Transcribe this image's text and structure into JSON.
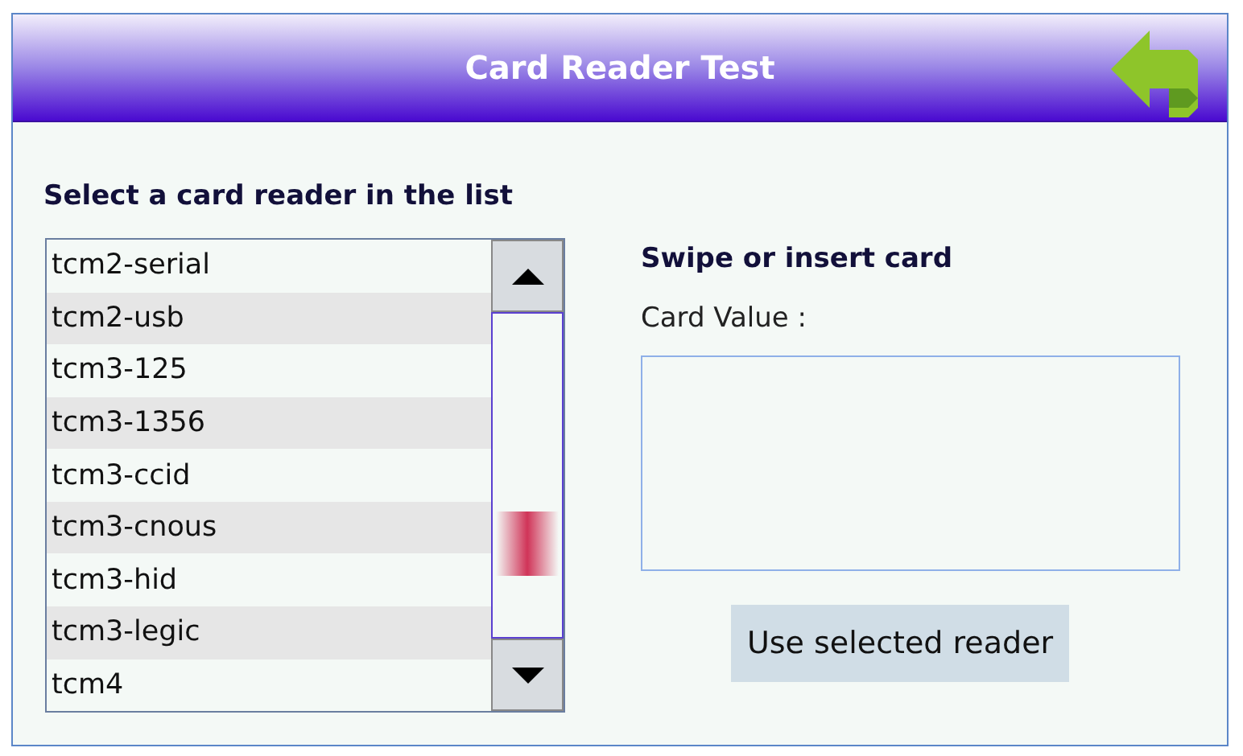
{
  "window": {
    "title": "Card Reader Test"
  },
  "reader_list": {
    "heading": "Select a card reader in the list",
    "items": [
      "tcm2-serial",
      "tcm2-usb",
      "tcm3-125",
      "tcm3-1356",
      "tcm3-ccid",
      "tcm3-cnous",
      "tcm3-hid",
      "tcm3-legic",
      "tcm4"
    ]
  },
  "card_panel": {
    "heading": "Swipe or insert card",
    "value_label": "Card Value :",
    "button": "Use selected reader"
  }
}
